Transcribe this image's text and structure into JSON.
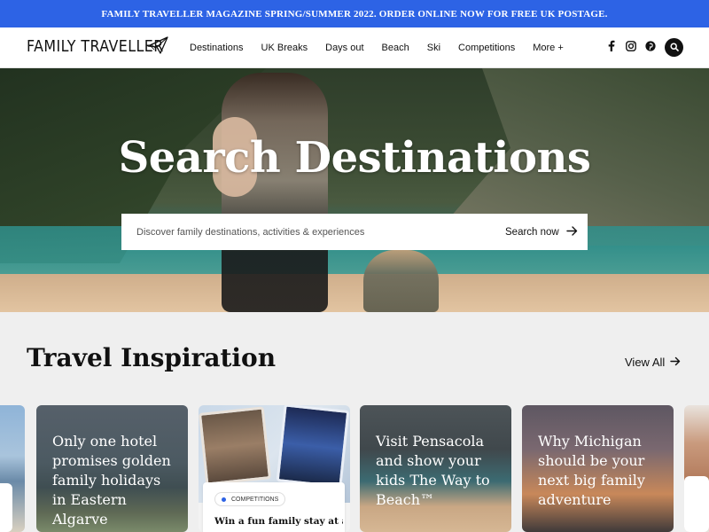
{
  "promo": {
    "text": "FAMILY TRAVELLER MAGAZINE SPRING/SUMMER 2022. ORDER ONLINE NOW FOR FREE UK POSTAGE."
  },
  "header": {
    "logo": "FAMILY TRAVELLER",
    "menu": [
      "Destinations",
      "UK Breaks",
      "Days out",
      "Beach",
      "Ski",
      "Competitions",
      "More +"
    ],
    "socials": [
      "facebook-icon",
      "instagram-icon",
      "pinterest-icon"
    ]
  },
  "hero": {
    "title": "Search Destinations",
    "search_placeholder": "Discover family destinations, activities & experiences",
    "search_button": "Search now"
  },
  "inspiration": {
    "title": "Travel Inspiration",
    "view_all": "View All",
    "cards": [
      {
        "title": "Only one hotel promises golden family holidays in Eastern Algarve"
      },
      {
        "badge": "COMPETITIONS",
        "title": "Win a fun family stay at a"
      },
      {
        "title": "Visit Pensacola and show your kids The Way to Beach™"
      },
      {
        "title": "Why Michigan should be your next big family adventure"
      }
    ]
  },
  "colors": {
    "promo_bg": "#2d63e5",
    "accent": "#2d63e5",
    "text": "#111111",
    "page_bg": "#efefef"
  }
}
